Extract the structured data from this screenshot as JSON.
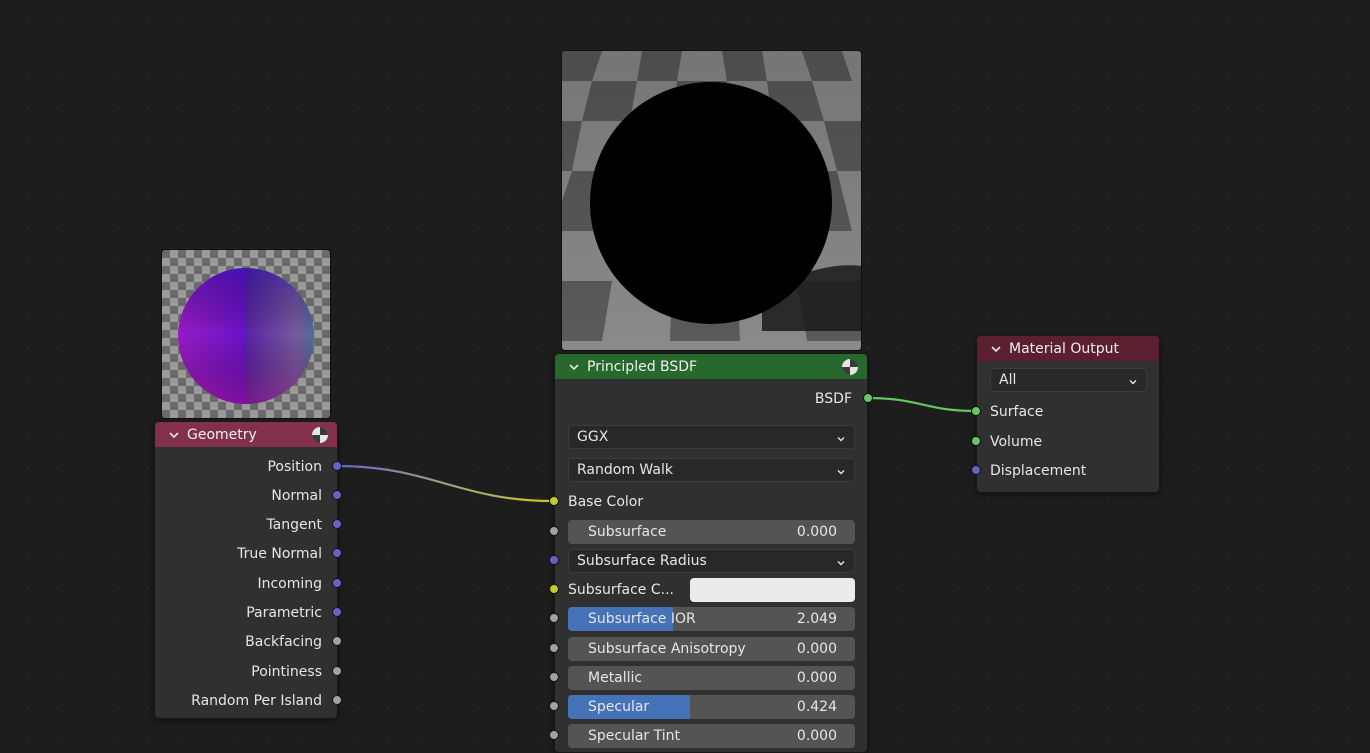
{
  "geometry_node": {
    "title": "Geometry",
    "outputs": [
      "Position",
      "Normal",
      "Tangent",
      "True Normal",
      "Incoming",
      "Parametric",
      "Backfacing",
      "Pointiness",
      "Random Per Island"
    ]
  },
  "bsdf_node": {
    "title": "Principled BSDF",
    "output_label": "BSDF",
    "distribution": "GGX",
    "subsurface_method": "Random Walk",
    "base_color_label": "Base Color",
    "subsurface": {
      "label": "Subsurface",
      "value": "0.000",
      "fraction": 0
    },
    "subsurface_radius": "Subsurface Radius",
    "subsurface_color_label": "Subsurface C...",
    "subsurface_color_hex": "#ebebeb",
    "subsurface_ior": {
      "label": "Subsurface IOR",
      "value": "2.049",
      "fraction": 0.365
    },
    "subsurface_anisotropy": {
      "label": "Subsurface Anisotropy",
      "value": "0.000",
      "fraction": 0
    },
    "metallic": {
      "label": "Metallic",
      "value": "0.000",
      "fraction": 0
    },
    "specular": {
      "label": "Specular",
      "value": "0.424",
      "fraction": 0.424
    },
    "specular_tint": {
      "label": "Specular Tint",
      "value": "0.000",
      "fraction": 0
    }
  },
  "output_node": {
    "title": "Material Output",
    "target": "All",
    "inputs": [
      "Surface",
      "Volume",
      "Displacement"
    ]
  },
  "colors": {
    "geometry_header": "#83314a",
    "bsdf_header": "#27692c",
    "output_header": "#5b1f30",
    "vector_socket": "#6363c7",
    "color_socket": "#c7c729",
    "float_socket": "#a1a1a1",
    "shader_socket": "#63c763",
    "slider_fill": "#4672b8"
  },
  "icons": [
    "chevron-down-icon",
    "material-preview-ball-icon"
  ]
}
